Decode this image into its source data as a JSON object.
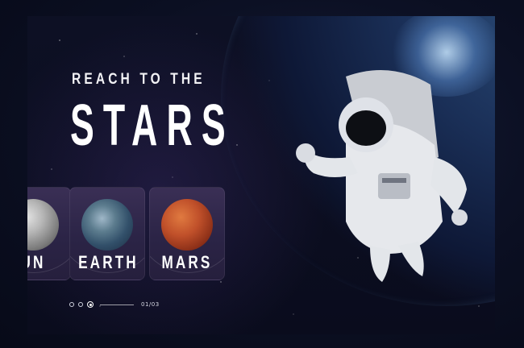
{
  "hero": {
    "tagline": "REACH TO THE",
    "headline": "STARS"
  },
  "planets": [
    {
      "label": "UN",
      "icon": "moon"
    },
    {
      "label": "EARTH",
      "icon": "earth"
    },
    {
      "label": "MARS",
      "icon": "mars"
    }
  ],
  "pagination": {
    "counter": "01/03"
  }
}
